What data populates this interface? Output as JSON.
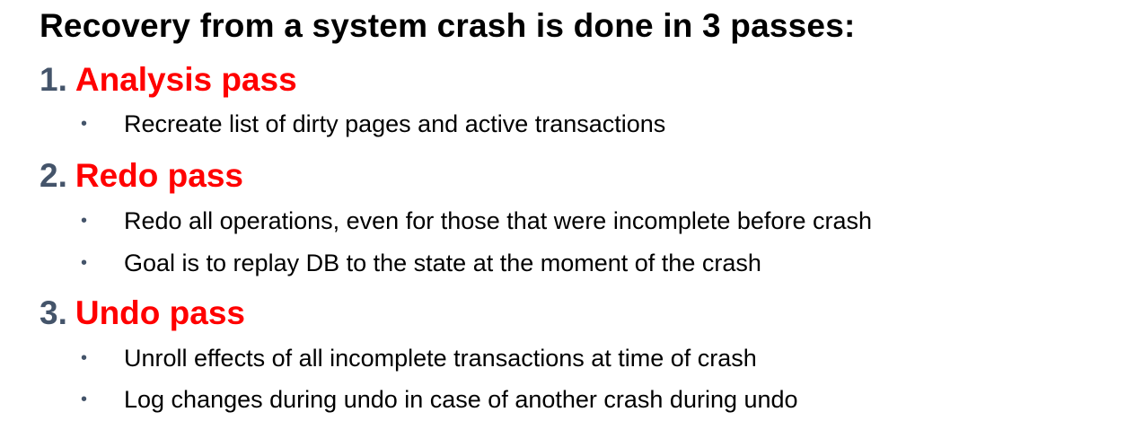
{
  "heading": "Recovery from a system crash is done in 3 passes:",
  "bullet_glyph": "•",
  "passes": [
    {
      "number": "1.",
      "title": "Analysis pass",
      "bullets": [
        "Recreate list of dirty pages and active transactions"
      ]
    },
    {
      "number": "2.",
      "title": "Redo pass",
      "bullets": [
        "Redo all operations, even for those that were incomplete before crash",
        "Goal is to replay DB to the state at the moment of the crash"
      ]
    },
    {
      "number": "3.",
      "title": "Undo pass",
      "bullets": [
        "Unroll effects of all incomplete transactions at time of crash",
        "Log changes during undo in case of another crash during undo"
      ]
    }
  ],
  "colors": {
    "heading": "#000000",
    "pass_number": "#44546a",
    "pass_title": "#ff0000",
    "bullet_text": "#000000",
    "bullet_dot": "#44546a"
  }
}
